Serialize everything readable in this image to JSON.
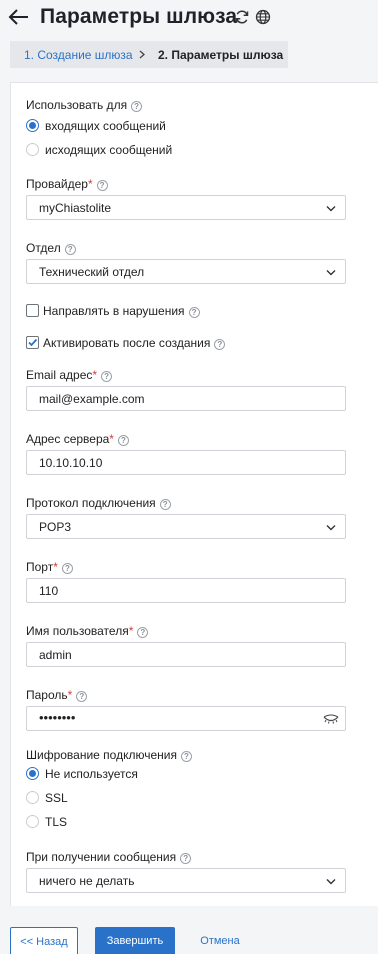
{
  "header": {
    "title": "Параметры шлюза",
    "back_icon": "arrow-left-icon",
    "refresh_icon": "refresh-icon",
    "globe_icon": "globe-icon"
  },
  "breadcrumbs": {
    "step1": "1. Создание шлюза",
    "step2": "2. Параметры шлюза"
  },
  "form": {
    "use_for": {
      "label": "Использовать для",
      "options": [
        "входящих сообщений",
        "исходящих сообщений"
      ],
      "selected": "входящих сообщений"
    },
    "provider": {
      "label": "Провайдер",
      "value": "myChiastolite"
    },
    "department": {
      "label": "Отдел",
      "value": "Технический отдел"
    },
    "route_violations": {
      "label": "Направлять в нарушения",
      "checked": false
    },
    "activate_after": {
      "label": "Активировать после создания",
      "checked": true
    },
    "email": {
      "label": "Email адрес",
      "value": "mail@example.com"
    },
    "server": {
      "label": "Адрес сервера",
      "value": "10.10.10.10"
    },
    "protocol": {
      "label": "Протокол подключения",
      "value": "POP3"
    },
    "port": {
      "label": "Порт",
      "value": "110"
    },
    "username": {
      "label": "Имя пользователя",
      "value": "admin"
    },
    "password": {
      "label": "Пароль",
      "masked": "••••••••"
    },
    "encryption": {
      "label": "Шифрование подключения",
      "options": [
        "Не используется",
        "SSL",
        "TLS"
      ],
      "selected": "Не используется"
    },
    "on_receive": {
      "label": "При получении сообщения",
      "value": "ничего не делать"
    },
    "required_mark": "*",
    "help_mark": "?"
  },
  "footer": {
    "back": "<< Назад",
    "finish": "Завершить",
    "cancel": "Отмена"
  },
  "colors": {
    "accent": "#2a72c9",
    "required": "#d23c3c"
  }
}
